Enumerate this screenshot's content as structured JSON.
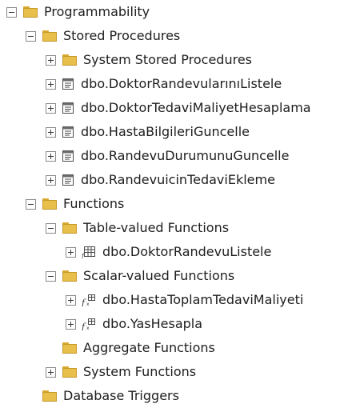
{
  "tree": {
    "programmability": "Programmability",
    "stored_procedures": "Stored Procedures",
    "system_stored_procedures": "System Stored Procedures",
    "procedures": [
      "dbo.DoktorRandevularınıListele",
      "dbo.DoktorTedaviMaliyetHesaplama",
      "dbo.HastaBilgileriGuncelle",
      "dbo.RandevuDurumunuGuncelle",
      "dbo.RandevuicinTedaviEkleme"
    ],
    "functions": "Functions",
    "table_valued_functions": "Table-valued Functions",
    "table_functions": [
      "dbo.DoktorRandevuListele"
    ],
    "scalar_valued_functions": "Scalar-valued Functions",
    "scalar_functions": [
      "dbo.HastaToplamTedaviMaliyeti",
      "dbo.YasHesapla"
    ],
    "aggregate_functions": "Aggregate Functions",
    "system_functions": "System Functions",
    "database_triggers": "Database Triggers"
  },
  "icons": {
    "folder": "folder-icon",
    "stored_procedure": "stored-procedure-icon",
    "table_function": "table-valued-function-icon",
    "scalar_function": "scalar-valued-function-icon"
  },
  "colors": {
    "folder": "#e8bf4b",
    "text": "#1e1e1e",
    "expander_border": "#8a8a8a"
  }
}
